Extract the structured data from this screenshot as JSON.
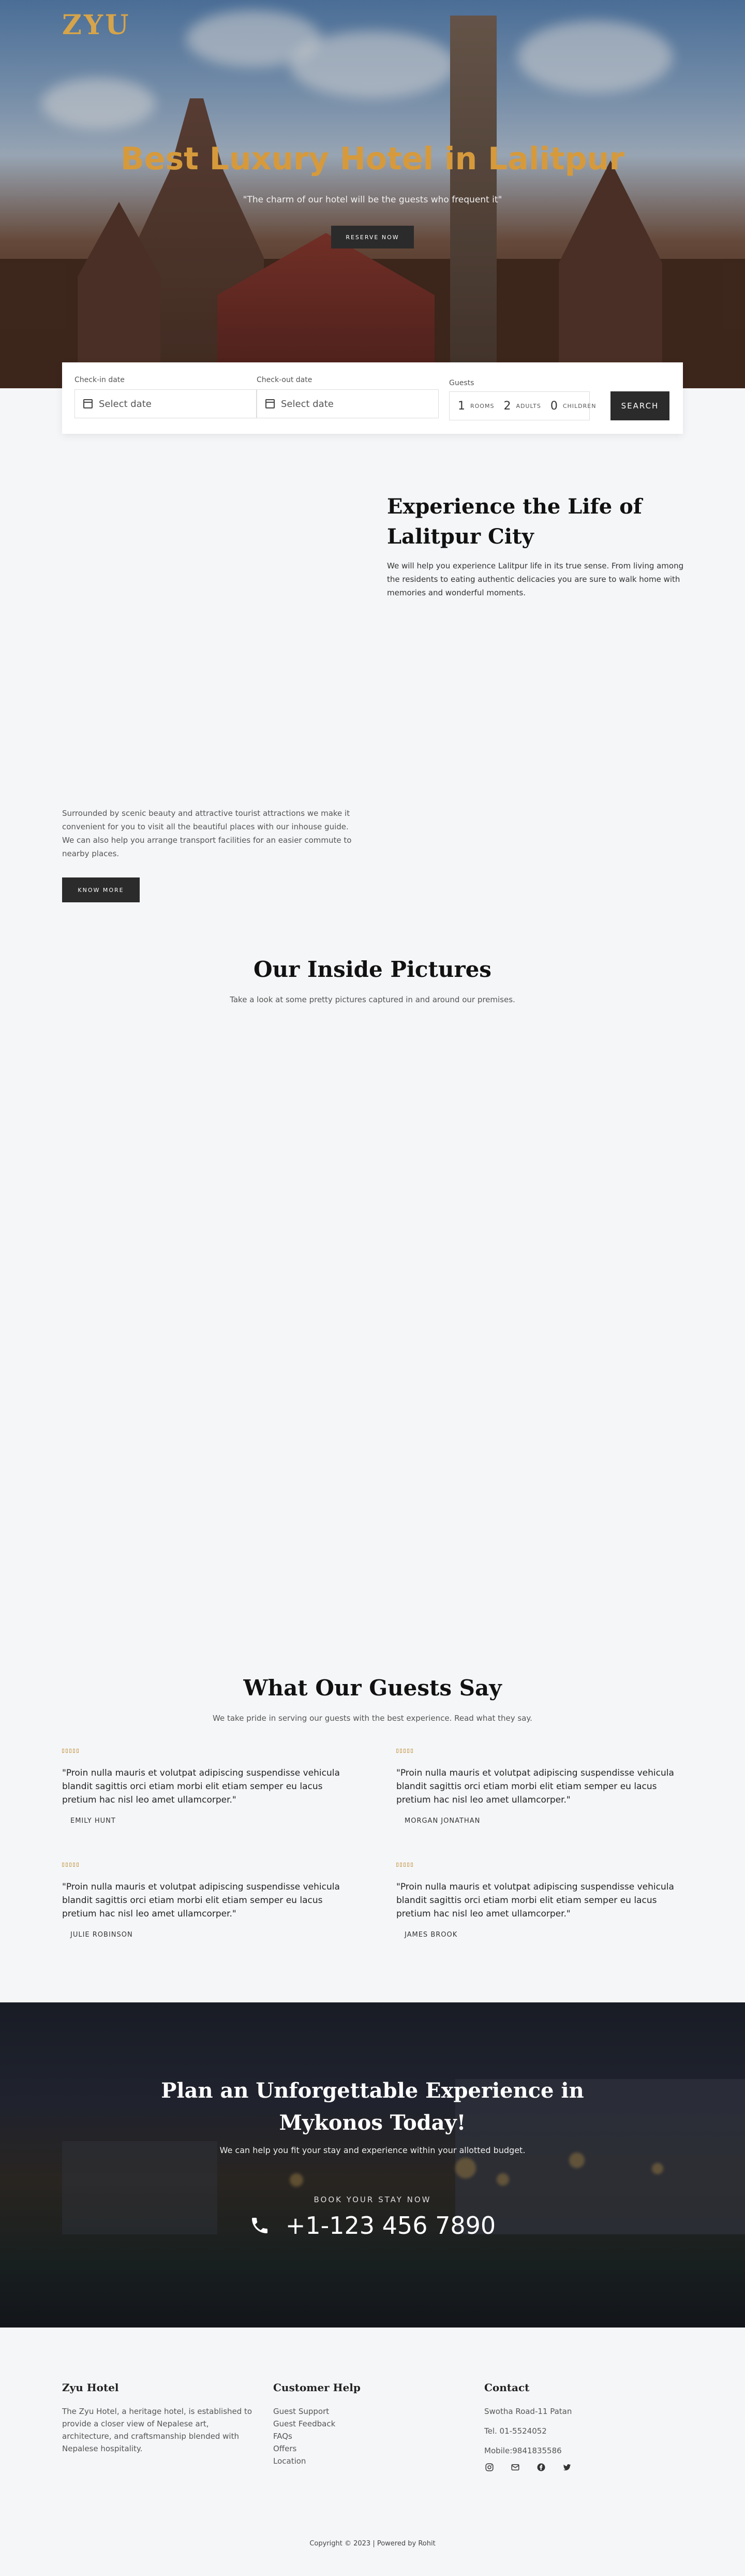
{
  "brand": {
    "logo": "ZYU",
    "accent": "#d69a3c",
    "dark": "#2b2b2b"
  },
  "hero": {
    "title": "Best Luxury Hotel in Lalitpur",
    "subtitle": "\"The charm of our hotel will be the guests who frequent it\"",
    "button": "RESERVE NOW"
  },
  "booking": {
    "checkin_label": "Check-in date",
    "checkin_placeholder": "Select date",
    "checkout_label": "Check-out date",
    "checkout_placeholder": "Select date",
    "guests_label": "Guests",
    "rooms_value": "1",
    "rooms_label": "ROOMS",
    "adults_value": "2",
    "adults_label": "ADULTS",
    "children_value": "0",
    "children_label": "CHILDREN",
    "search_button": "SEARCH"
  },
  "experience": {
    "title": "Experience the Life of Lalitpur City",
    "text": "We will help you experience Lalitpur life in its true sense. From living among the residents to eating authentic delicacies you are sure to walk home with memories and wonderful moments.",
    "left_text": "Surrounded by scenic beauty and attractive tourist attractions we make it convenient for you to visit all the beautiful places with our inhouse guide. We can also help you arrange transport facilities for an easier commute to nearby places.",
    "button": "KNOW MORE"
  },
  "gallery": {
    "title": "Our Inside Pictures",
    "subtitle": "Take a look at some pretty pictures captured in and around our premises."
  },
  "testimonials": {
    "title": "What Our Guests Say",
    "subtitle": "We take pride in serving our guests with the best experience. Read what they say.",
    "items": [
      {
        "quote": "\"Proin nulla mauris et volutpat adipiscing suspendisse vehicula blandit sagittis orci etiam morbi elit etiam semper eu lacus pretium hac nisl leo amet ullamcorper.\"",
        "author": "EMILY HUNT",
        "rating": 5
      },
      {
        "quote": "\"Proin nulla mauris et volutpat adipiscing suspendisse vehicula blandit sagittis orci etiam morbi elit etiam semper eu lacus pretium hac nisl leo amet ullamcorper.\"",
        "author": "MORGAN JONATHAN",
        "rating": 5
      },
      {
        "quote": "\"Proin nulla mauris et volutpat adipiscing suspendisse vehicula blandit sagittis orci etiam morbi elit etiam semper eu lacus pretium hac nisl leo amet ullamcorper.\"",
        "author": "JULIE ROBINSON",
        "rating": 5
      },
      {
        "quote": "\"Proin nulla mauris et volutpat adipiscing suspendisse vehicula blandit sagittis orci etiam morbi elit etiam semper eu lacus pretium hac nisl leo amet ullamcorper.\"",
        "author": "JAMES BROOK",
        "rating": 5
      }
    ]
  },
  "cta": {
    "title_line1": "Plan an Unforgettable Experience in",
    "title_line2": "Mykonos Today!",
    "subtitle": "We can help you fit your stay and experience within your allotted budget.",
    "book_label": "BOOK YOUR STAY NOW",
    "phone": "+1-123 456 7890"
  },
  "footer": {
    "col1_title": "Zyu Hotel",
    "col1_text": "The Zyu Hotel, a heritage hotel, is established to provide a closer view of Nepalese art, architecture, and craftsmanship blended with Nepalese hospitality.",
    "col2_title": "Customer Help",
    "col2_links": [
      "Guest Support",
      "Guest Feedback",
      "FAQs",
      "Offers",
      "Location"
    ],
    "col3_title": "Contact",
    "address": "Swotha Road-11 Patan",
    "tel": "Tel. 01-5524052",
    "mobile": "Mobile:9841835586",
    "social_icons": [
      "instagram-icon",
      "mail-icon",
      "facebook-icon",
      "twitter-icon"
    ],
    "copyright": "Copyright © 2023 | Powered by Rohit"
  }
}
